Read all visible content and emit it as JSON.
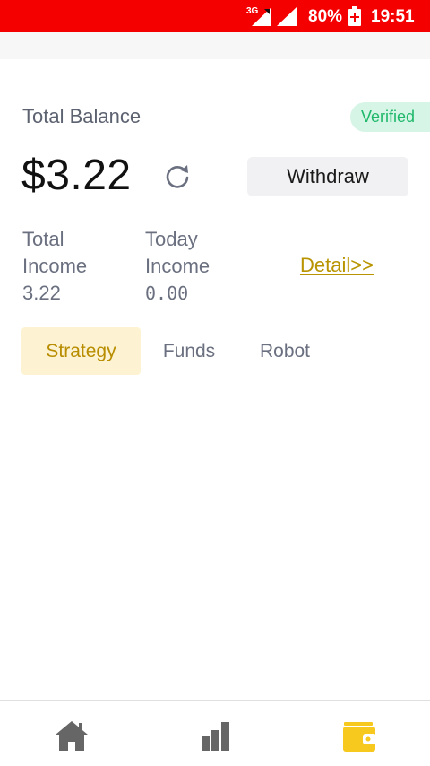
{
  "status_bar": {
    "network": "3G",
    "battery_percent": "80%",
    "time": "19:51"
  },
  "balance": {
    "label": "Total Balance",
    "verified_badge": "Verified",
    "amount": "$3.22",
    "withdraw_label": "Withdraw"
  },
  "stats": {
    "total_income_label": "Total Income",
    "total_income_value": "3.22",
    "today_income_label": "Today Income",
    "today_income_value": "0.00",
    "detail_link": "Detail>>"
  },
  "tabs": [
    {
      "label": "Strategy",
      "active": true
    },
    {
      "label": "Funds",
      "active": false
    },
    {
      "label": "Robot",
      "active": false
    }
  ],
  "bottom_nav": [
    {
      "icon": "home-icon",
      "active": false
    },
    {
      "icon": "bar-chart-icon",
      "active": false
    },
    {
      "icon": "wallet-icon",
      "active": true
    }
  ],
  "colors": {
    "status_bar": "#f50000",
    "accent": "#f7c81e",
    "verified_bg": "#d6f5e6",
    "verified_text": "#1fb86a",
    "link": "#b89400"
  }
}
